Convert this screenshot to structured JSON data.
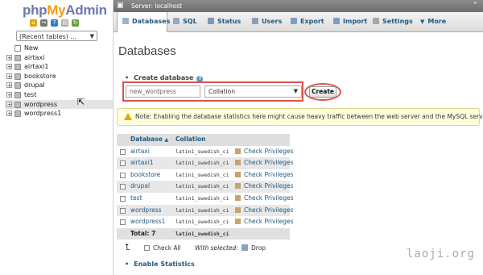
{
  "sidebar": {
    "logo": {
      "php": "php",
      "my": "My",
      "admin": "Admin"
    },
    "recent_tables": "(Recent tables) ...",
    "tree": [
      {
        "label": "New",
        "type": "new"
      },
      {
        "label": "airtaxi",
        "type": "db"
      },
      {
        "label": "airtaxi1",
        "type": "db"
      },
      {
        "label": "bookstore",
        "type": "db"
      },
      {
        "label": "drupal",
        "type": "db"
      },
      {
        "label": "test",
        "type": "db"
      },
      {
        "label": "wordpress",
        "type": "db",
        "selected": true
      },
      {
        "label": "wordpress1",
        "type": "db"
      }
    ]
  },
  "topbar": {
    "server": "Server: localhost"
  },
  "tabs": [
    {
      "label": "Databases",
      "active": true,
      "icon": "database-icon"
    },
    {
      "label": "SQL",
      "icon": "sql-icon"
    },
    {
      "label": "Status",
      "icon": "status-icon"
    },
    {
      "label": "Users",
      "icon": "users-icon"
    },
    {
      "label": "Export",
      "icon": "export-icon"
    },
    {
      "label": "Import",
      "icon": "import-icon"
    },
    {
      "label": "Settings",
      "icon": "settings-icon"
    },
    {
      "label": "More",
      "icon": "more-icon"
    }
  ],
  "main": {
    "title": "Databases",
    "create": {
      "label": "Create database",
      "db_name_value": "new_wordpress",
      "collation_value": "Collation",
      "button": "Create"
    },
    "notice": "Note: Enabling the database statistics here might cause heavy traffic between the web server and the MySQL server.",
    "table": {
      "headers": {
        "database": "Database",
        "collation": "Collation"
      },
      "rows": [
        {
          "database": "airtaxi",
          "collation": "latin1_swedish_ci",
          "action": "Check Privileges"
        },
        {
          "database": "airtaxi1",
          "collation": "latin1_swedish_ci",
          "action": "Check Privileges"
        },
        {
          "database": "bookstore",
          "collation": "latin1_swedish_ci",
          "action": "Check Privileges"
        },
        {
          "database": "drupal",
          "collation": "latin1_swedish_ci",
          "action": "Check Privileges"
        },
        {
          "database": "test",
          "collation": "latin1_swedish_ci",
          "action": "Check Privileges"
        },
        {
          "database": "wordpress",
          "collation": "latin1_swedish_ci",
          "action": "Check Privileges"
        },
        {
          "database": "wordpress1",
          "collation": "latin1_swedish_ci",
          "action": "Check Privileges"
        }
      ],
      "total": {
        "label": "Total: 7",
        "collation": "latin1_swedish_ci"
      }
    },
    "actions": {
      "check_all": "Check All",
      "with_selected": "With selected:",
      "drop": "Drop"
    },
    "enable_statistics": "Enable Statistics"
  },
  "watermark": "laoji.org",
  "colors": {
    "link": "#235a81",
    "highlight_border": "#d9534f",
    "notice_bg": "#ffffdd"
  }
}
